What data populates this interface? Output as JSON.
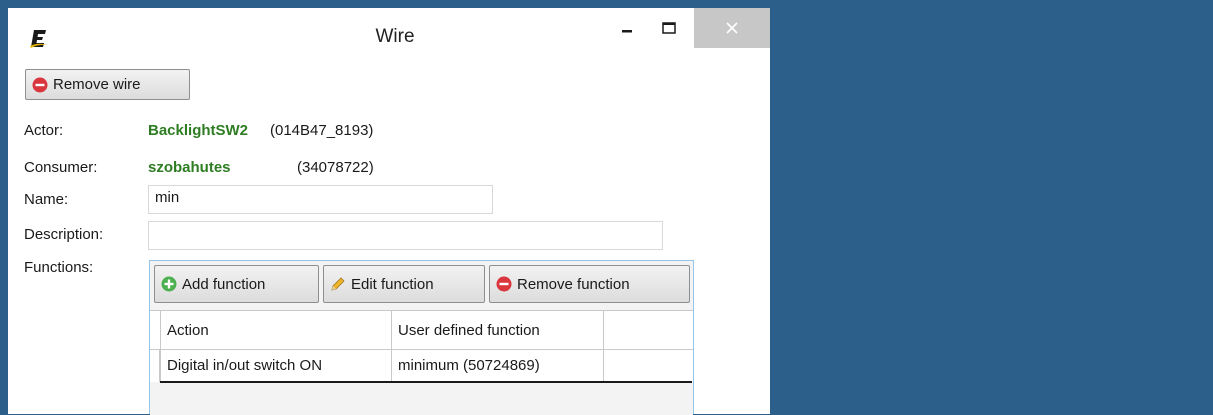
{
  "window": {
    "title": "Wire",
    "icon": "app-e-logo",
    "controls": [
      "minimize",
      "maximize",
      "close"
    ]
  },
  "toolbar": {
    "remove_wire_label": "Remove wire"
  },
  "fields": {
    "actor_label": "Actor:",
    "actor_name": "BacklightSW2",
    "actor_id": "(014B47_8193)",
    "consumer_label": "Consumer:",
    "consumer_name": "szobahutes",
    "consumer_id": "(34078722)",
    "name_label": "Name:",
    "name_value": "min",
    "description_label": "Description:",
    "description_value": "",
    "functions_label": "Functions:"
  },
  "functions": {
    "add_label": "Add function",
    "edit_label": "Edit function",
    "remove_label": "Remove function",
    "columns": [
      "Action",
      "User defined function"
    ],
    "rows": [
      {
        "action": "Digital in/out switch ON",
        "function": "minimum (50724869)"
      }
    ]
  },
  "colors": {
    "desktop": "#2c5f8a",
    "accent_green": "#2e7d22",
    "remove_red": "#d9363e",
    "add_green": "#4caf50"
  }
}
